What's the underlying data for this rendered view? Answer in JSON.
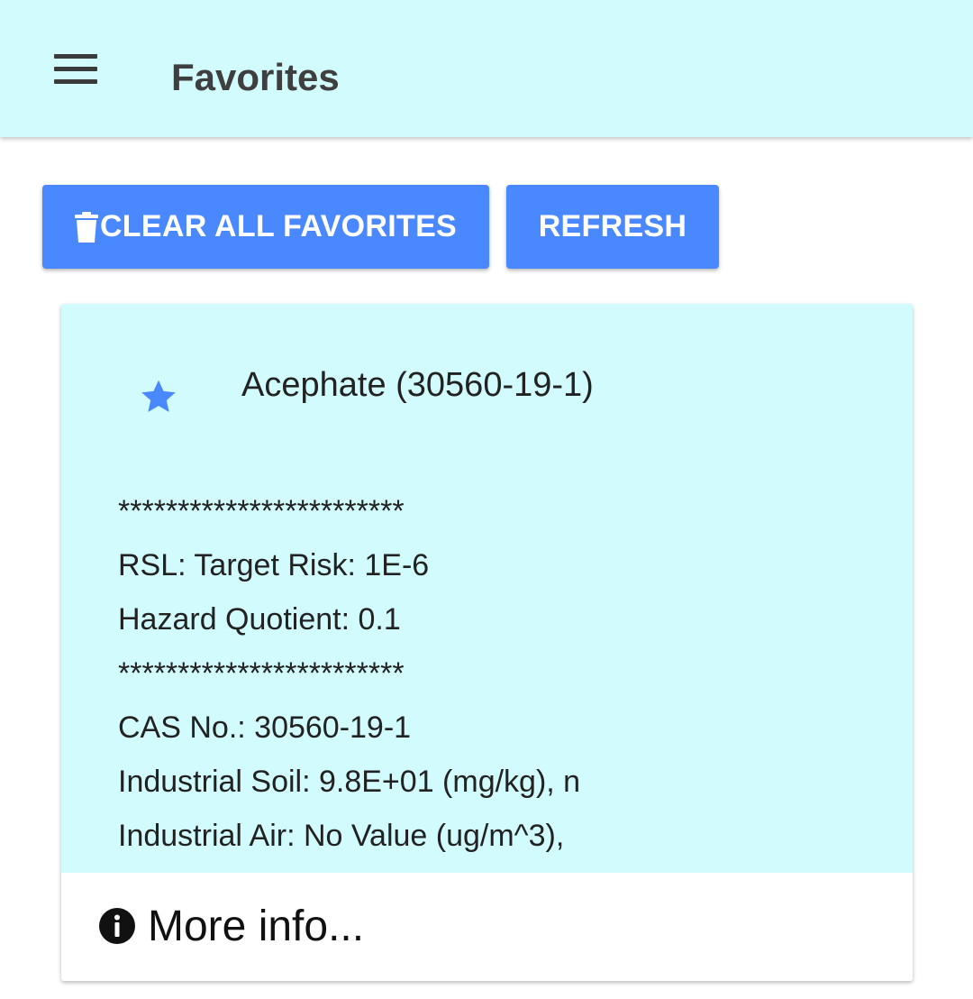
{
  "header": {
    "title": "Favorites",
    "background": "#d2fbfd",
    "menu_icon": "hamburger-menu-icon"
  },
  "toolbar": {
    "clear_label": "CLEAR ALL FAVORITES",
    "clear_icon": "trash-icon",
    "refresh_label": "REFRESH",
    "button_color": "#4a88ff"
  },
  "card": {
    "favorite_icon": "star-icon",
    "star_color": "#4a88ff",
    "title": "Acephate (30560-19-1)",
    "lines": [
      "************************",
      "RSL: Target Risk: 1E-6",
      "Hazard Quotient: 0.1",
      "************************",
      "CAS No.: 30560-19-1",
      "Industrial Soil: 9.8E+01 (mg/kg), n",
      "Industrial Air: No Value (ug/m^3),"
    ],
    "more_info_label": "More info...",
    "more_info_icon": "info-icon"
  }
}
